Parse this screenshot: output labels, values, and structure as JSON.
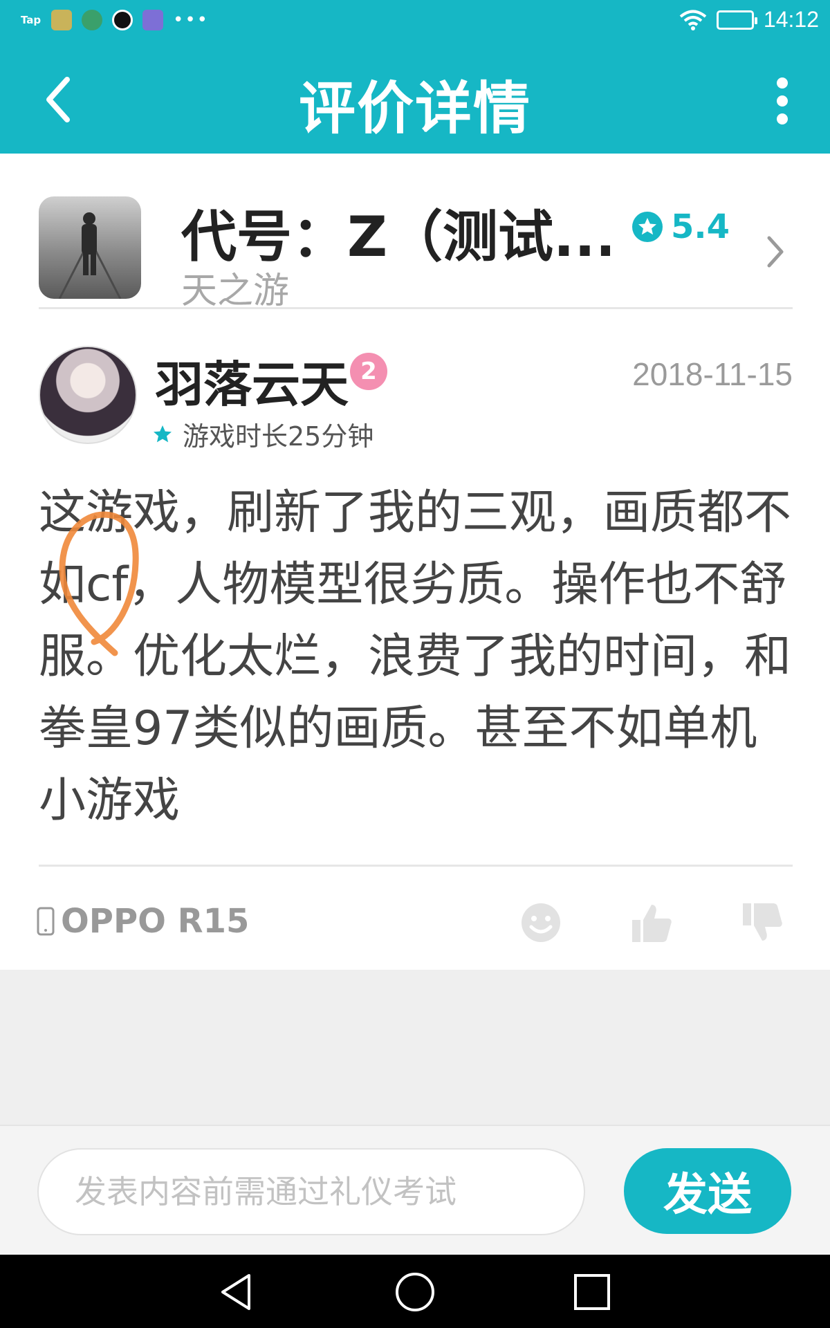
{
  "status_bar": {
    "tap_label": "Tap",
    "app_icons": [
      "wallet-app-icon",
      "browser-app-icon",
      "qq-app-icon",
      "gallery-app-icon"
    ],
    "more_label": "•••",
    "time": "14:12"
  },
  "header": {
    "title": "评价详情"
  },
  "game": {
    "name": "代号：Z（测试...",
    "developer": "天之游",
    "score": "5.4"
  },
  "review": {
    "username": "羽落云天",
    "level": "2",
    "date": "2018-11-15",
    "playtime": "游戏时长25分钟",
    "text": "这游戏，刷新了我的三观，画质都不如cf，人物模型很劣质。操作也不舒服。优化太烂，浪费了我的时间，和拳皇97类似的画质。甚至不如单机小游戏",
    "device": "OPPO R15"
  },
  "comment_bar": {
    "placeholder": "发表内容前需通过礼仪考试",
    "value": "",
    "send_label": "发送"
  },
  "colors": {
    "accent": "#16b7c5",
    "annotation": "#f0883a",
    "level_badge": "#f48fb1"
  }
}
